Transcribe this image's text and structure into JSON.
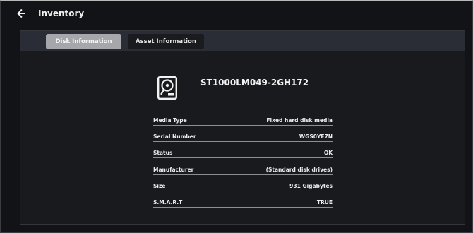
{
  "header": {
    "back_icon": "arrow-left-icon",
    "title": "Inventory"
  },
  "tabs": [
    {
      "label": "Disk Information",
      "active": true
    },
    {
      "label": "Asset Information",
      "active": false
    }
  ],
  "disk": {
    "icon": "hard-disk-icon",
    "model": "ST1000LM049-2GH172",
    "properties": [
      {
        "label": "Media Type",
        "value": "Fixed hard disk media"
      },
      {
        "label": "Serial Number",
        "value": "WGS0YE7N"
      },
      {
        "label": "Status",
        "value": "OK"
      },
      {
        "label": "Manufacturer",
        "value": "(Standard disk drives)"
      },
      {
        "label": "Size",
        "value": "931 Gigabytes"
      },
      {
        "label": "S.M.A.R.T",
        "value": "TRUE"
      }
    ]
  },
  "colors": {
    "background": "#121316",
    "panel": "#191a1e",
    "tabbar": "#2a2d36",
    "active_tab": "#a6a7ab",
    "inactive_tab": "#1a1b1f",
    "text": "#e8e8e8"
  }
}
